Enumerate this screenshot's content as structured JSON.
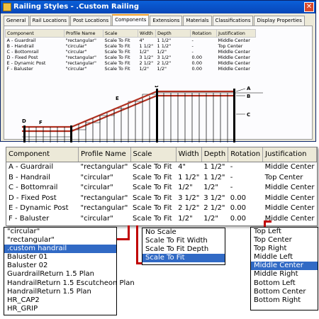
{
  "window": {
    "title": "Railing Styles - .Custom Railing"
  },
  "tabs": [
    {
      "label": "General",
      "active": false
    },
    {
      "label": "Rail Locations",
      "active": false
    },
    {
      "label": "Post Locations",
      "active": false
    },
    {
      "label": "Components",
      "active": true
    },
    {
      "label": "Extensions",
      "active": false
    },
    {
      "label": "Materials",
      "active": false
    },
    {
      "label": "Classifications",
      "active": false
    },
    {
      "label": "Display Properties",
      "active": false
    }
  ],
  "table": {
    "headers": [
      "Component",
      "Profile Name",
      "Scale",
      "Width",
      "Depth",
      "Rotation",
      "Justification"
    ],
    "rows": [
      [
        "A - Guardrail",
        "\"rectangular\"",
        "Scale To Fit",
        "4\"",
        "1 1/2\"",
        "-",
        "Middle Center"
      ],
      [
        "B - Handrail",
        "\"circular\"",
        "Scale To Fit",
        "1 1/2\"",
        "1 1/2\"",
        "-",
        "Top Center"
      ],
      [
        "C - Bottomrail",
        "\"circular\"",
        "Scale To Fit",
        "1/2\"",
        "1/2\"",
        "-",
        "Middle Center"
      ],
      [
        "D - Fixed Post",
        "\"rectangular\"",
        "Scale To Fit",
        "3 1/2\"",
        "3 1/2\"",
        "0.00",
        "Middle Center"
      ],
      [
        "E - Dynamic Post",
        "\"rectangular\"",
        "Scale To Fit",
        "2 1/2\"",
        "2 1/2\"",
        "0.00",
        "Middle Center"
      ],
      [
        "F - Baluster",
        "\"circular\"",
        "Scale To Fit",
        "1/2\"",
        "1/2\"",
        "0.00",
        "Middle Center"
      ]
    ]
  },
  "drawing_labels": {
    "A": "A",
    "B": "B",
    "C": "C",
    "D": "D",
    "E": "E",
    "F": "F"
  },
  "profile_dropdown": {
    "options": [
      "\"circular\"",
      "\"rectangular\"",
      ".custom handrail",
      "Baluster 01",
      "Baluster 02",
      "GuardrailReturn 1.5 Plan",
      "HandrailReturn 1.5 Escutcheon Plan",
      "HandrailReturn 1.5 Plan",
      "HR_CAP2",
      "HR_GRIP"
    ],
    "selected_index": 2
  },
  "scale_dropdown": {
    "options": [
      "No Scale",
      "Scale To Fit Width",
      "Scale To Fit Depth",
      "Scale To Fit"
    ],
    "selected_index": 3
  },
  "justification_dropdown": {
    "options": [
      "Top Left",
      "Top Center",
      "Top Right",
      "Middle Left",
      "Middle Center",
      "Middle Right",
      "Bottom Left",
      "Bottom Center",
      "Bottom Right"
    ],
    "selected_index": 4
  },
  "colors": {
    "accent": "#316ac5",
    "callout": "#c00000",
    "rail": "#b03020"
  }
}
